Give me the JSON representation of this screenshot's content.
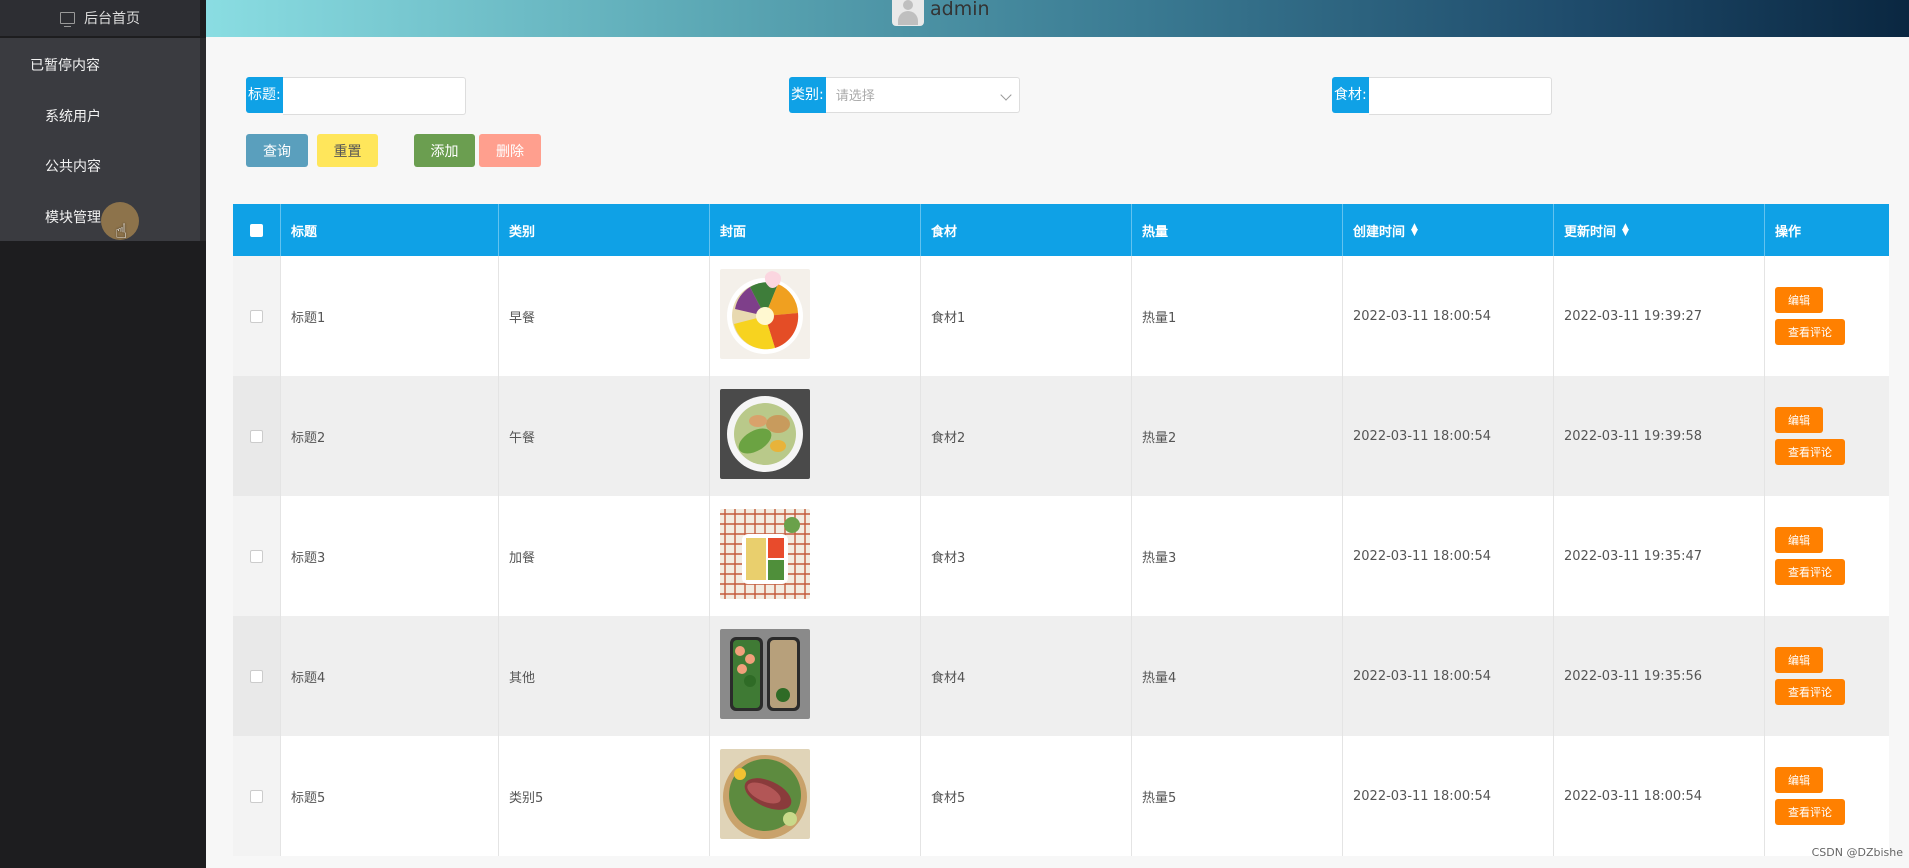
{
  "sidebar": {
    "home_label": "后台首页",
    "group_title": "已暂停内容",
    "items": [
      "系统用户",
      "公共内容",
      "模块管理"
    ]
  },
  "header": {
    "username": "admin"
  },
  "search": {
    "title_label": "标题:",
    "category_label": "类别:",
    "category_placeholder": "请选择",
    "ingredient_label": "食材:"
  },
  "buttons": {
    "query": "查询",
    "reset": "重置",
    "add": "添加",
    "delete": "删除"
  },
  "tooltip": "",
  "table": {
    "columns": [
      "标题",
      "类别",
      "封面",
      "食材",
      "热量",
      "创建时间",
      "更新时间",
      "操作"
    ],
    "rows": [
      {
        "title": "标题1",
        "category": "早餐",
        "ingredient": "食材1",
        "calories": "热量1",
        "created": "2022-03-11 18:00:54",
        "updated": "2022-03-11 19:39:27"
      },
      {
        "title": "标题2",
        "category": "午餐",
        "ingredient": "食材2",
        "calories": "热量2",
        "created": "2022-03-11 18:00:54",
        "updated": "2022-03-11 19:39:58"
      },
      {
        "title": "标题3",
        "category": "加餐",
        "ingredient": "食材3",
        "calories": "热量3",
        "created": "2022-03-11 18:00:54",
        "updated": "2022-03-11 19:35:47"
      },
      {
        "title": "标题4",
        "category": "其他",
        "ingredient": "食材4",
        "calories": "热量4",
        "created": "2022-03-11 18:00:54",
        "updated": "2022-03-11 19:35:56"
      },
      {
        "title": "标题5",
        "category": "类别5",
        "ingredient": "食材5",
        "calories": "热量5",
        "created": "2022-03-11 18:00:54",
        "updated": "2022-03-11 18:00:54"
      }
    ],
    "edit_label": "编辑",
    "comments_label": "查看评论"
  },
  "colors": {
    "primary": "#0fa1e6",
    "action": "#ff8000",
    "query": "#5a9fbd",
    "reset": "#ffe65b",
    "add": "#6b9e50",
    "delete": "#ff9f8e"
  },
  "watermark": "CSDN @DZbishe"
}
